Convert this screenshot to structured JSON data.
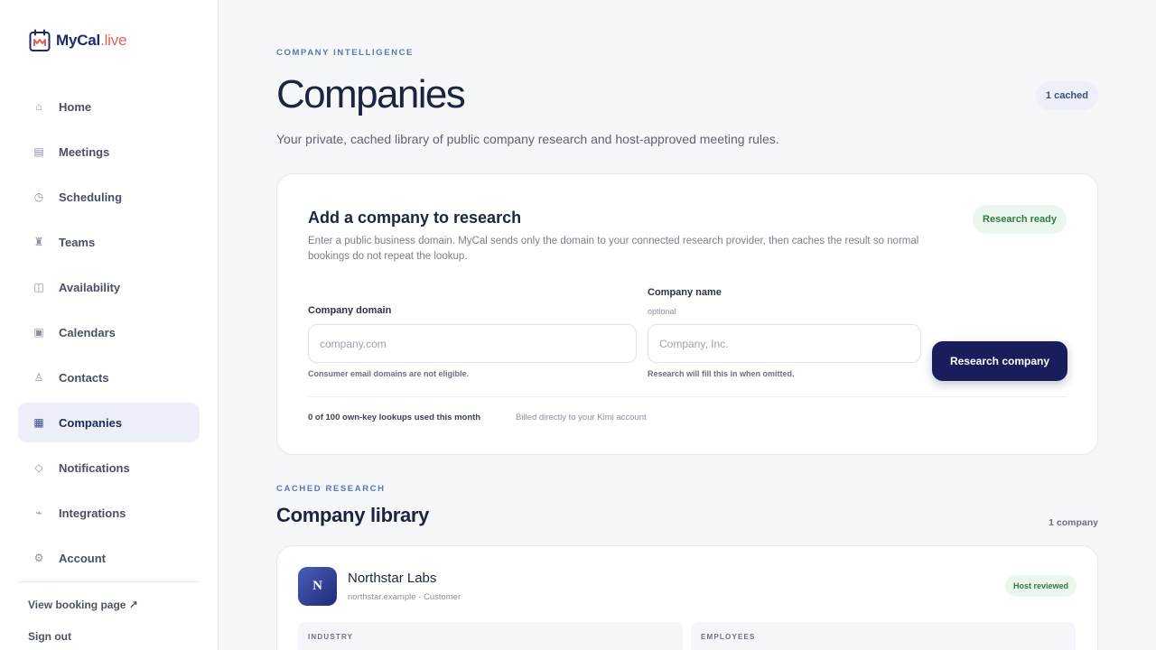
{
  "brand": {
    "name_main": "MyCal",
    "name_accent": ".live"
  },
  "sidebar": {
    "items": [
      {
        "label": "Home",
        "icon": "⌂"
      },
      {
        "label": "Meetings",
        "icon": "▤"
      },
      {
        "label": "Scheduling",
        "icon": "◷"
      },
      {
        "label": "Teams",
        "icon": "♜"
      },
      {
        "label": "Availability",
        "icon": "◫"
      },
      {
        "label": "Calendars",
        "icon": "▣"
      },
      {
        "label": "Contacts",
        "icon": "♙"
      },
      {
        "label": "Companies",
        "icon": "▦"
      },
      {
        "label": "Notifications",
        "icon": "◇"
      },
      {
        "label": "Integrations",
        "icon": "⌁"
      },
      {
        "label": "Account",
        "icon": "⚙"
      }
    ],
    "active": "Companies",
    "booking_link": "View booking page ↗",
    "sign_out": "Sign out"
  },
  "header": {
    "eyebrow": "COMPANY INTELLIGENCE",
    "title": "Companies",
    "cached_badge": "1 cached",
    "subtitle": "Your private, cached library of public company research and host-approved meeting rules."
  },
  "research_card": {
    "title": "Add a company to research",
    "description": "Enter a public business domain. MyCal sends only the domain to your connected research provider, then caches the result so normal bookings do not repeat the lookup.",
    "status_badge": "Research ready",
    "domain": {
      "label": "Company domain",
      "placeholder": "company.com",
      "value": "",
      "help": "Consumer email domains are not eligible."
    },
    "name": {
      "label": "Company name",
      "sublabel": "optional",
      "placeholder": "Company, Inc.",
      "value": "",
      "help": "Research will fill this in when omitted."
    },
    "button_label": "Research company",
    "usage": "0 of 100 own-key lookups used this month",
    "billing": "Billed directly to your Kimi account"
  },
  "library": {
    "eyebrow": "CACHED RESEARCH",
    "title": "Company library",
    "count": "1 company",
    "companies": [
      {
        "initial": "N",
        "name": "Northstar Labs",
        "meta": "northstar.example · Customer",
        "badge": "Host reviewed",
        "stats": [
          {
            "label": "INDUSTRY"
          },
          {
            "label": "EMPLOYEES"
          }
        ]
      }
    ]
  },
  "colors": {
    "brand_navy": "#1f2a6b",
    "brand_accent": "#e2625a",
    "button": "#1a1d5c",
    "success": "#2f7a45",
    "eyebrow": "#5b76b0"
  }
}
